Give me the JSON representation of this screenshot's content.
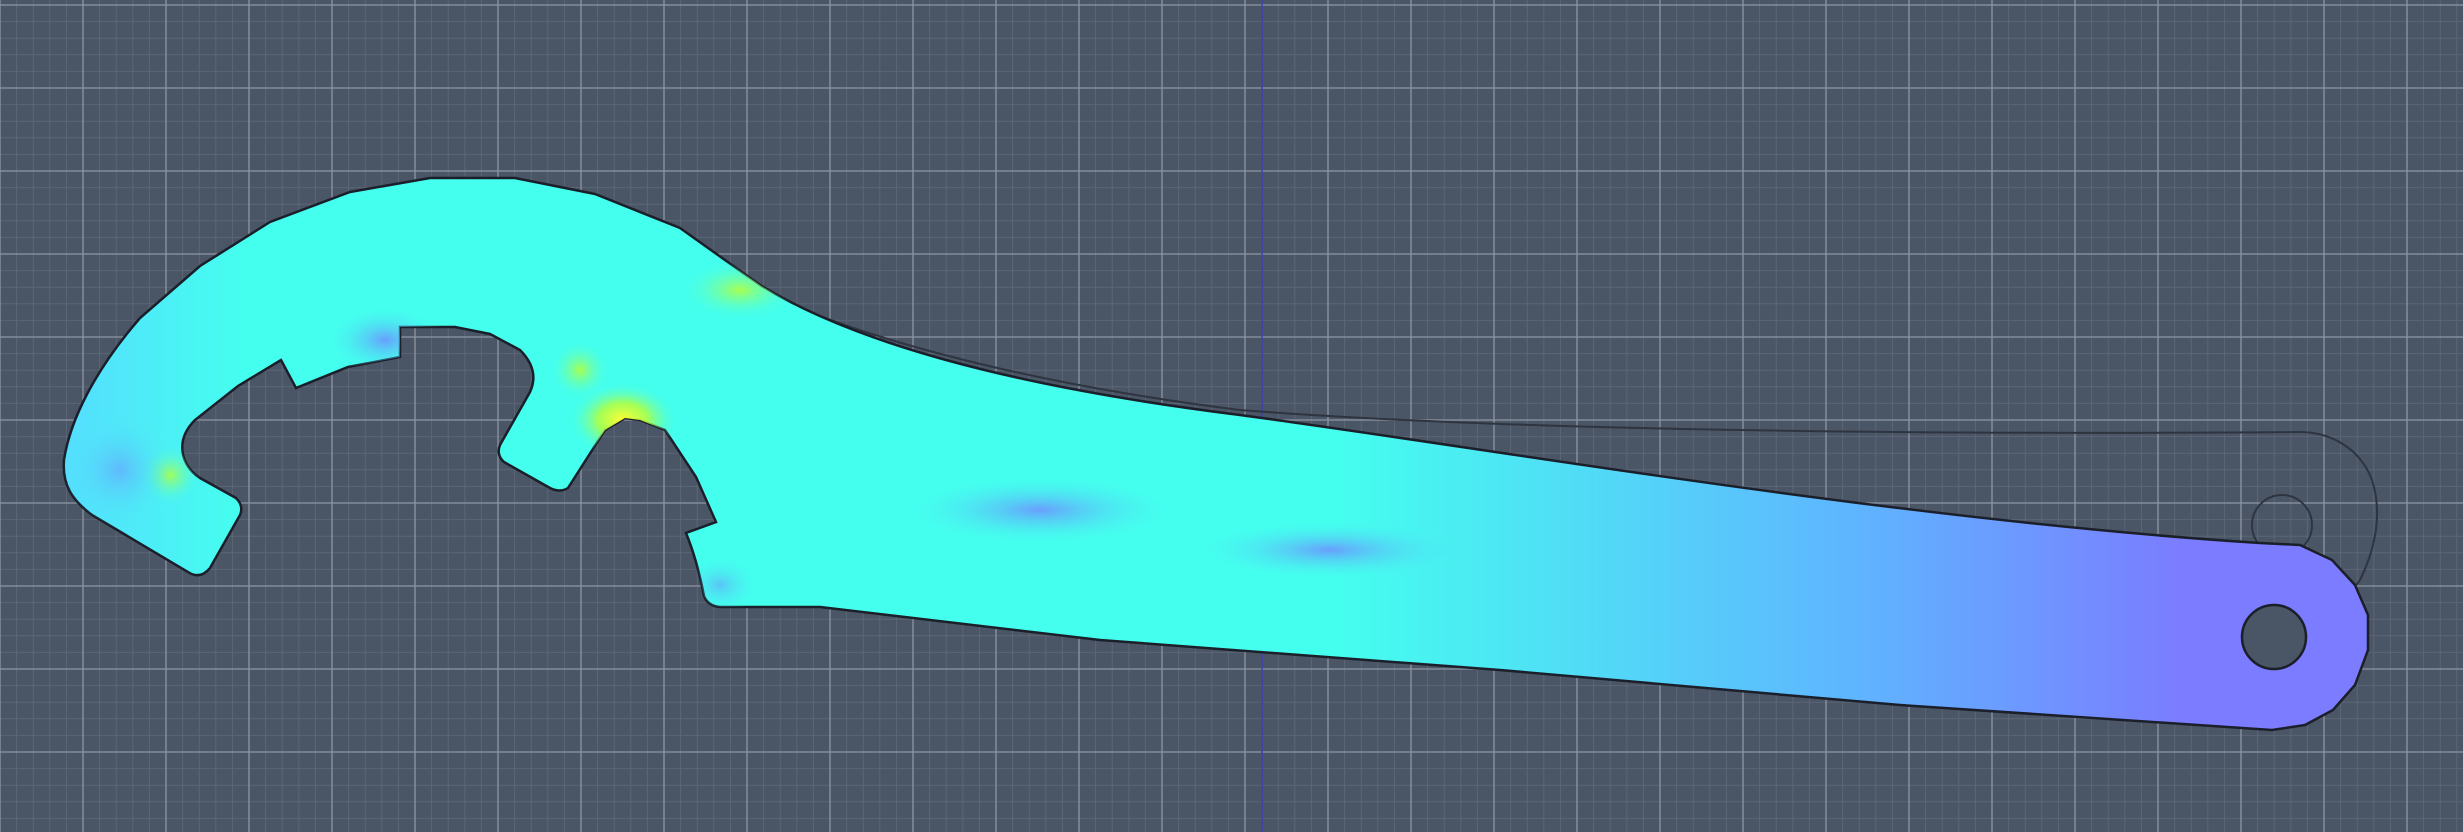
{
  "viewport": {
    "background": "#4a5566",
    "grid_minor_color": "#5b6676",
    "grid_major_color": "#8d96a3",
    "axis_color": "#3b3fb4",
    "grid": true
  },
  "part": {
    "outline_color": "#1b1f2a",
    "undeformed_outline_color": "#2f3540",
    "stress_colormap": [
      "#7b7cff",
      "#5fb4ff",
      "#44ffee",
      "#b4ff3c",
      "#ffff33"
    ],
    "hole_center_label": "",
    "features": [
      "hook-jaw",
      "spanner-tooth-upper",
      "spanner-tooth-lower",
      "handle",
      "pivot-hole"
    ]
  }
}
